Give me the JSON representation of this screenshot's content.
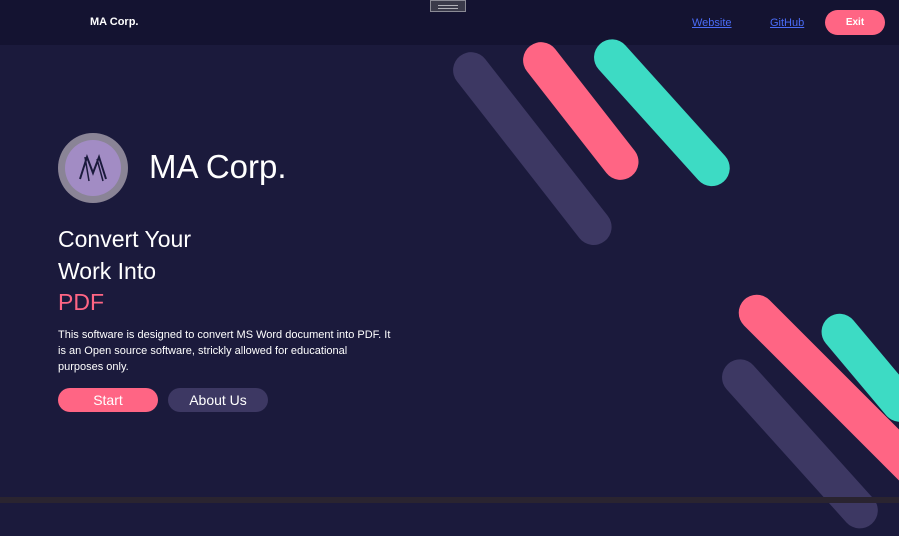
{
  "topbar": {
    "brand": "MA Corp.",
    "links": [
      "Website",
      "GitHub"
    ],
    "exit_label": "Exit"
  },
  "hero": {
    "title": "MA Corp.",
    "logo_text": "M",
    "headline_line1": "Convert Your",
    "headline_line2": "Work Into",
    "headline_accent": "PDF",
    "description": "This software is designed to convert MS Word document into PDF. It is an Open source software, strickly allowed for educational purposes only.",
    "start_label": "Start",
    "about_label": "About Us"
  },
  "colors": {
    "background": "#1b1a3c",
    "topbar": "#141331",
    "accent_pink": "#ff6584",
    "accent_teal": "#3ddbc4",
    "muted_purple": "#3d3863",
    "link_blue": "#4a6cf7"
  }
}
